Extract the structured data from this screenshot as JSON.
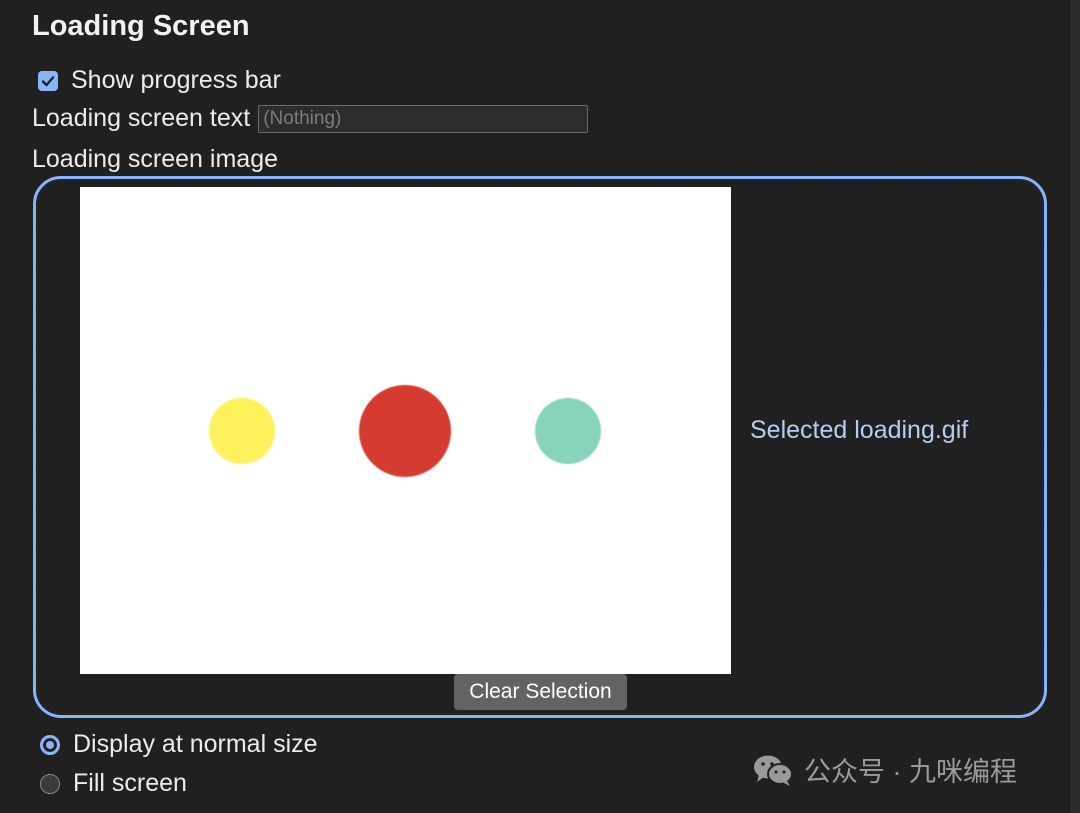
{
  "section": {
    "title": "Loading Screen"
  },
  "progress_bar": {
    "label": "Show progress bar",
    "checked": true
  },
  "loading_text": {
    "label": "Loading screen text",
    "placeholder": "(Nothing)",
    "value": ""
  },
  "loading_image": {
    "label": "Loading screen image",
    "selected_text": "Selected loading.gif",
    "clear_button": "Clear Selection",
    "preview_dots": [
      {
        "color": "#fdf25b"
      },
      {
        "color": "#d53b31"
      },
      {
        "color": "#88d3bb"
      }
    ]
  },
  "display_mode": {
    "options": [
      {
        "label": "Display at normal size",
        "selected": true
      },
      {
        "label": "Fill screen",
        "selected": false
      }
    ]
  },
  "watermark": {
    "text": "公众号 · 九咪编程",
    "icon": "wechat-icon"
  },
  "colors": {
    "accent": "#8ab4f8",
    "background": "#202021",
    "button": "#636363",
    "selected_text": "#b6cdf1"
  }
}
